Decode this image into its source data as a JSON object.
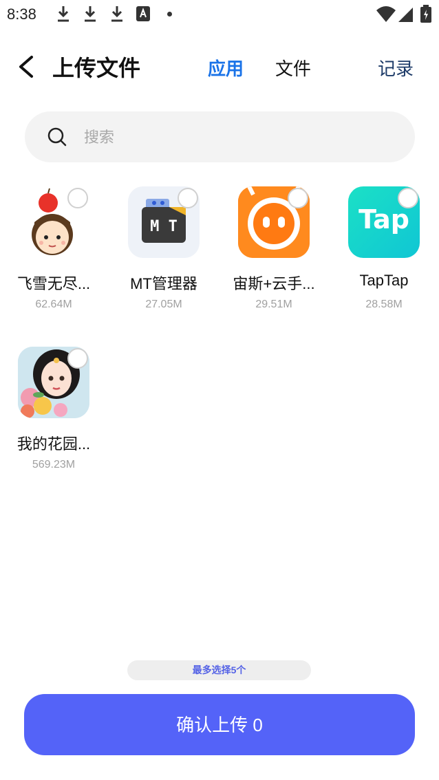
{
  "status_bar": {
    "time": "8:38",
    "icons": [
      "download-icon",
      "download-icon",
      "download-icon",
      "translate-icon",
      "dot-icon",
      "wifi-icon",
      "signal-icon",
      "battery-icon"
    ]
  },
  "header": {
    "title": "上传文件",
    "tabs": [
      {
        "label": "应用",
        "active": true
      },
      {
        "label": "文件",
        "active": false
      }
    ],
    "records_label": "记录"
  },
  "search": {
    "placeholder": "搜索"
  },
  "apps": [
    {
      "name": "飞雪无尽...",
      "size": "62.64M",
      "icon": "avatar-boy-apple-icon"
    },
    {
      "name": "MT管理器",
      "size": "27.05M",
      "icon": "mt-manager-icon",
      "icon_text": "M T"
    },
    {
      "name": "宙斯+云手...",
      "size": "29.51M",
      "icon": "zeus-cloud-phone-icon"
    },
    {
      "name": "TapTap",
      "size": "28.58M",
      "icon": "taptap-icon",
      "icon_text": "Tap"
    },
    {
      "name": "我的花园...",
      "size": "569.23M",
      "icon": "garden-girl-icon"
    }
  ],
  "footer": {
    "limit_text": "最多选择5个",
    "confirm_label": "确认上传 0"
  },
  "colors": {
    "accent": "#1a73e8",
    "confirm_button": "#5463f8",
    "taptap": "#14d4c8",
    "zeus": "#ff8a1e"
  }
}
